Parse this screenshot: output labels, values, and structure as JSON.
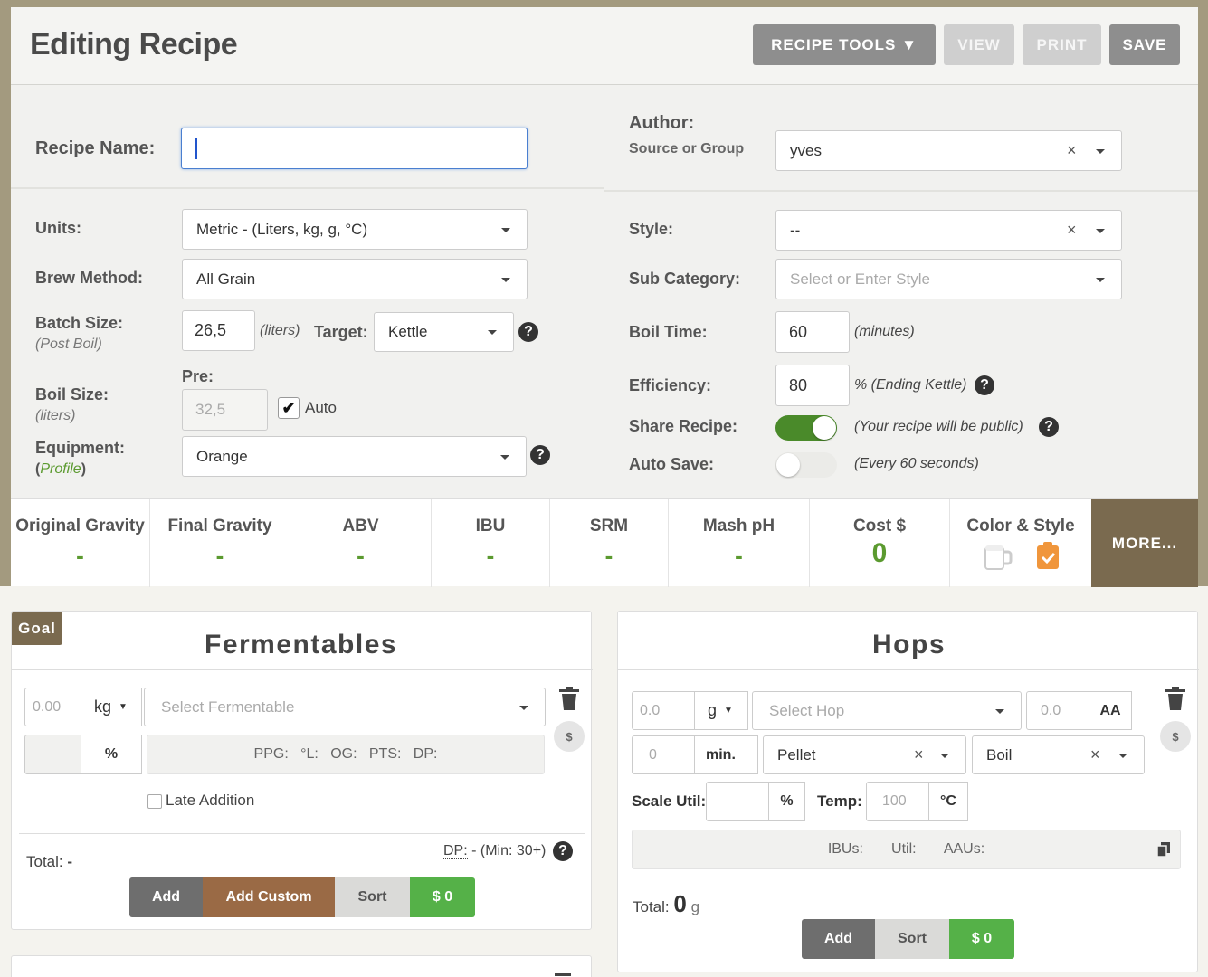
{
  "header": {
    "title": "Editing Recipe",
    "recipe_tools": "RECIPE TOOLS ▼",
    "view": "VIEW",
    "print": "PRINT",
    "save": "SAVE"
  },
  "form": {
    "recipe_name_label": "Recipe Name:",
    "recipe_name_value": "",
    "author_label": "Author:",
    "source_label": "Source or Group",
    "author_value": "yves",
    "units_label": "Units:",
    "units_value": "Metric - (Liters, kg, g, °C)",
    "brew_method_label": "Brew Method:",
    "brew_method_value": "All Grain",
    "batch_size_label": "Batch Size:",
    "batch_size_sub": "(Post Boil)",
    "batch_size_value": "26,5",
    "batch_unit": "(liters)",
    "target_label": "Target:",
    "target_value": "Kettle",
    "pre_label": "Pre:",
    "boil_size_label": "Boil Size:",
    "boil_size_sub": "(liters)",
    "boil_size_value": "32,5",
    "auto_label": "Auto",
    "equipment_label": "Equipment:",
    "equipment_open": "(",
    "equipment_profile": "Profile",
    "equipment_close": ")",
    "equipment_value": "Orange",
    "style_label": "Style:",
    "style_value": "--",
    "subcat_label": "Sub Category:",
    "subcat_placeholder": "Select or Enter Style",
    "boil_time_label": "Boil Time:",
    "boil_time_value": "60",
    "boil_time_unit": "(minutes)",
    "efficiency_label": "Efficiency:",
    "efficiency_value": "80",
    "efficiency_unit": "% (Ending Kettle)",
    "share_label": "Share Recipe:",
    "share_note": "(Your recipe will be public)",
    "share_on": true,
    "autosave_label": "Auto Save:",
    "autosave_note": "(Every 60 seconds)",
    "autosave_on": false
  },
  "stats": [
    {
      "label": "Original Gravity",
      "value": "-"
    },
    {
      "label": "Final Gravity",
      "value": "-"
    },
    {
      "label": "ABV",
      "value": "-"
    },
    {
      "label": "IBU",
      "value": "-"
    },
    {
      "label": "SRM",
      "value": "-"
    },
    {
      "label": "Mash pH",
      "value": "-"
    },
    {
      "label": "Cost $",
      "value": "0"
    },
    {
      "label": "Color & Style",
      "value": ""
    }
  ],
  "more": "MORE...",
  "fermentables": {
    "goal": "Goal",
    "title": "Fermentables",
    "amount_placeholder": "0.00",
    "unit": "kg",
    "select_placeholder": "Select Fermentable",
    "percent": "%",
    "info": "PPG:   °L:   OG:   PTS:   DP:",
    "late_addition": "Late Addition",
    "total_label": "Total:",
    "total_value": "-",
    "dp_label": "DP:",
    "dp_value": "- (Min: 30+)",
    "add": "Add",
    "add_custom": "Add Custom",
    "sort": "Sort",
    "cost": "$ 0",
    "dollar": "$"
  },
  "hops": {
    "title": "Hops",
    "amount_placeholder": "0.0",
    "unit": "g",
    "select_placeholder": "Select Hop",
    "aa_placeholder": "0.0",
    "aa": "AA",
    "time_placeholder": "0",
    "time_unit": "min.",
    "form_value": "Pellet",
    "use_value": "Boil",
    "scale_label": "Scale Util:",
    "percent": "%",
    "temp_label": "Temp:",
    "temp_placeholder": "100",
    "temp_unit": "°C",
    "info": "IBUs:       Util:       AAUs:",
    "total_label": "Total:",
    "total_value": "0",
    "total_unit": "g",
    "add": "Add",
    "sort": "Sort",
    "cost": "$ 0",
    "dollar": "$"
  },
  "colors": {
    "green": "#5b9a2f",
    "brown": "#9a6a45",
    "more_bg": "#7a6a4f"
  }
}
